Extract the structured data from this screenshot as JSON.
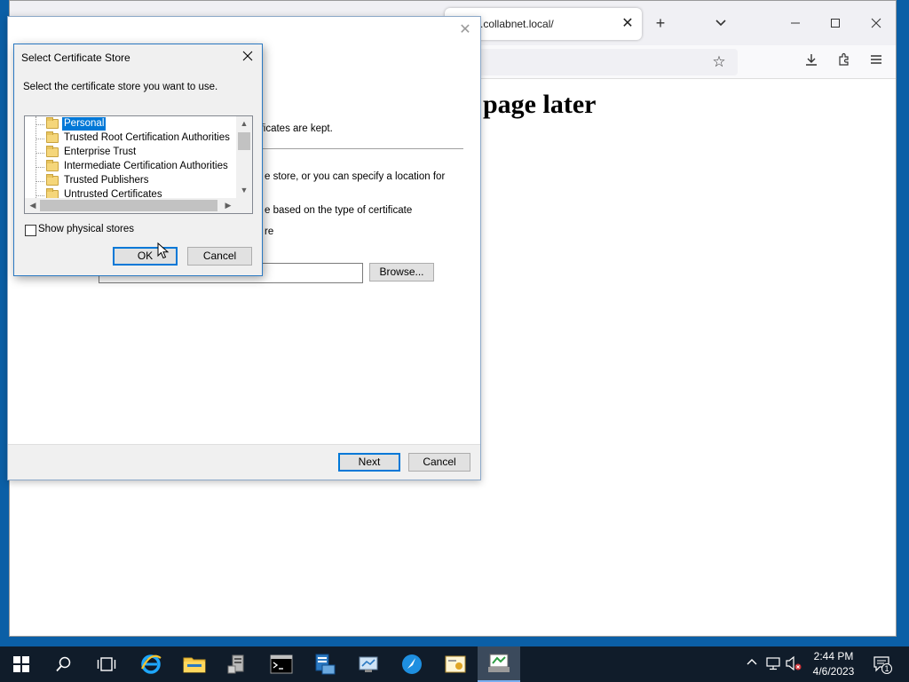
{
  "browser": {
    "tab_title": ".collabnet.local/",
    "tab_close_glyph": "✕",
    "page_heading": "page later",
    "icons": [
      "plus-icon",
      "chevron-down-icon",
      "minimize-icon",
      "maximize-icon",
      "close-icon",
      "star-icon",
      "download-icon",
      "extensions-icon",
      "menu-icon"
    ]
  },
  "wizard": {
    "fragment_kept": "rtificates are kept.",
    "fragment_store": "e store, or you can specify a location for",
    "fragment_based": "e based on the type of certificate",
    "fragment_re": "re",
    "browse_label": "Browse...",
    "next_label": "Next",
    "cancel_label": "Cancel"
  },
  "dialog": {
    "title": "Select Certificate Store",
    "instruction": "Select the certificate store you want to use.",
    "stores": [
      "Personal",
      "Trusted Root Certification Authorities",
      "Enterprise Trust",
      "Intermediate Certification Authorities",
      "Trusted Publishers",
      "Untrusted Certificates"
    ],
    "selected_store": "Personal",
    "show_physical_label": "Show physical stores",
    "show_physical_checked": false,
    "ok_label": "OK",
    "cancel_label": "Cancel"
  },
  "taskbar": {
    "time": "2:44 PM",
    "date": "4/6/2023",
    "notification_count": "1",
    "apps": [
      "internet-explorer",
      "file-explorer",
      "server-manager",
      "command-prompt",
      "remote-desktop",
      "network-tool",
      "app-circle",
      "certificate-manager",
      "certificate-import-wizard"
    ],
    "colors": {
      "taskbar_bg": "#101c2a",
      "desktop": "#0b5fa6",
      "selection": "#0078d7"
    }
  }
}
